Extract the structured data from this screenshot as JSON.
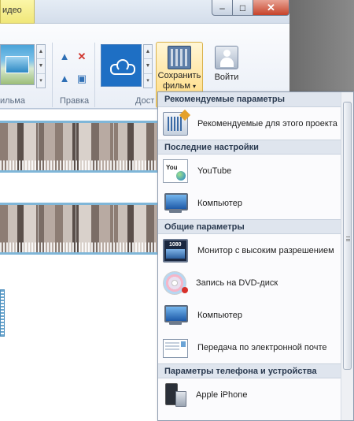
{
  "window": {
    "tab_label": "идео",
    "controls": {
      "minimize": "–",
      "maximize": "□",
      "close": "✕"
    },
    "help": "?"
  },
  "ribbon": {
    "groups": [
      {
        "label": "ильма"
      },
      {
        "label": "Правка"
      },
      {
        "label": "Дост"
      }
    ],
    "save_movie": {
      "line1": "Сохранить",
      "line2": "фильм",
      "arrow": "▾"
    },
    "sign_in": {
      "label": "Войти"
    },
    "edit_icons": {
      "rotate_left": "▲",
      "remove": "✕",
      "rotate_right": "▲",
      "select": "▣"
    }
  },
  "menu": {
    "sections": [
      {
        "header": "Рекомендуемые параметры",
        "items": [
          {
            "label": "Рекомендуемые для этого проекта",
            "icon": "recommend-icon"
          }
        ]
      },
      {
        "header": "Последние настройки",
        "items": [
          {
            "label": "YouTube",
            "icon": "youtube-icon"
          },
          {
            "label": "Компьютер",
            "icon": "computer-icon"
          }
        ]
      },
      {
        "header": "Общие параметры",
        "items": [
          {
            "label": "Монитор с высоким разрешением",
            "icon": "hd-monitor-icon"
          },
          {
            "label": "Запись на DVD-диск",
            "icon": "dvd-icon"
          },
          {
            "label": "Компьютер",
            "icon": "computer-icon"
          },
          {
            "label": "Передача по электронной почте",
            "icon": "email-icon"
          }
        ]
      },
      {
        "header": "Параметры телефона и устройства",
        "items": [
          {
            "label": "Apple iPhone",
            "icon": "iphone-icon"
          }
        ]
      }
    ]
  }
}
